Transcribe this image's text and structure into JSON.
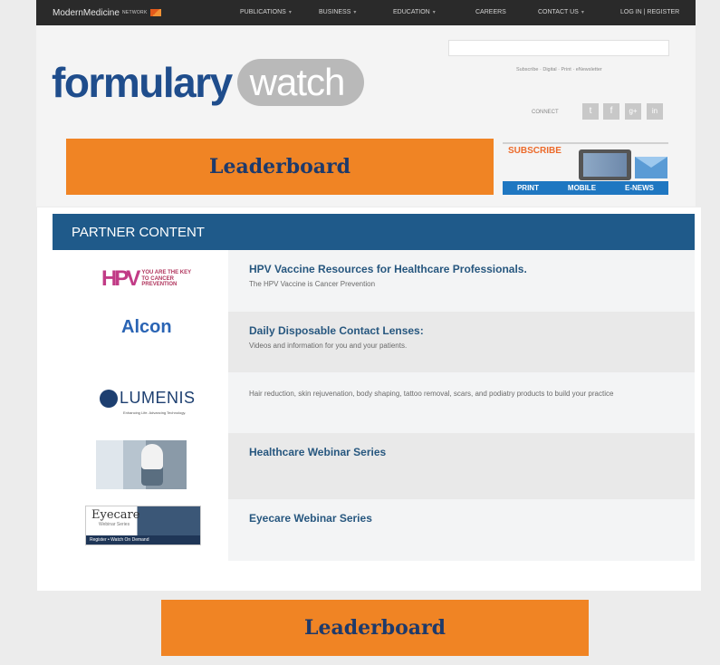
{
  "nav": {
    "brand": "ModernMedicine",
    "brand_suffix": "NETWORK",
    "items": [
      "PUBLICATIONS",
      "BUSINESS",
      "EDUCATION",
      "CAREERS",
      "CONTACT US",
      "LOG IN | REGISTER"
    ]
  },
  "header": {
    "search_placeholder": "",
    "utility_links": "Subscribe · Digital · Print · eNewsletter",
    "logo_primary": "formulary",
    "logo_secondary": "watch",
    "connect_label": "CONNECT",
    "social": [
      {
        "icon": "twitter-icon",
        "glyph": "t"
      },
      {
        "icon": "facebook-icon",
        "glyph": "f"
      },
      {
        "icon": "google-plus-icon",
        "glyph": "g+"
      },
      {
        "icon": "linkedin-icon",
        "glyph": "in"
      }
    ]
  },
  "ads": {
    "top_label": "Leaderboard",
    "bottom_label": "Leaderboard",
    "color": "#f08424"
  },
  "subscribe": {
    "title": "SUBSCRIBE",
    "options": [
      "PRINT",
      "MOBILE",
      "E-NEWS"
    ]
  },
  "partner": {
    "heading": "PARTNER CONTENT",
    "items": [
      {
        "logo": "hpv-logo",
        "title": "HPV Vaccine Resources for Healthcare Professionals.",
        "desc": "The HPV Vaccine is Cancer Prevention",
        "logo_mark": "HPV",
        "logo_text": "YOU ARE THE KEY TO CANCER PREVENTION"
      },
      {
        "logo": "alcon-logo",
        "title": "Daily Disposable Contact Lenses:",
        "desc": "Videos and information for you and your patients.",
        "logo_text": "Alcon"
      },
      {
        "logo": "lumenis-logo",
        "title": "",
        "desc": "Hair reduction, skin rejuvenation, body shaping, tattoo removal, scars, and podiatry products to build your practice",
        "logo_text": "LUMENIS",
        "logo_tag": "Enhancing Life. Advancing Technology."
      },
      {
        "logo": "webinar-photo",
        "title": "Healthcare Webinar Series",
        "desc": ""
      },
      {
        "logo": "eyecare-logo",
        "title": "Eyecare Webinar Series",
        "desc": "",
        "logo_text": "Eyecare",
        "logo_sub": "Webinar Series",
        "logo_bar": "Register • Watch On Demand"
      }
    ]
  }
}
